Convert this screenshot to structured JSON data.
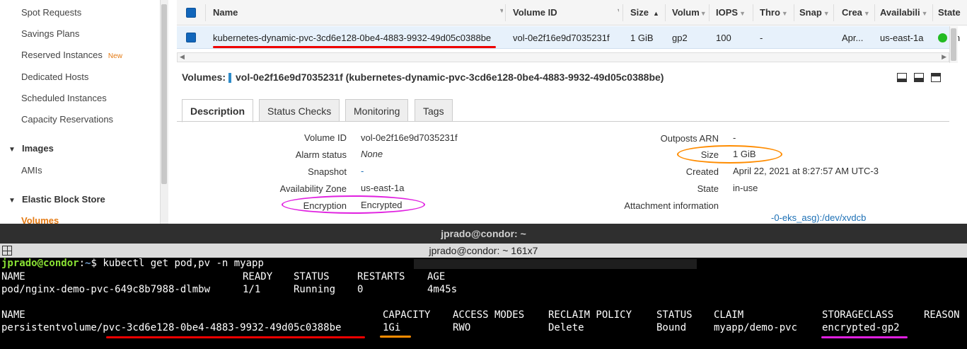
{
  "sidebar": {
    "items": [
      {
        "label": "Spot Requests"
      },
      {
        "label": "Savings Plans"
      },
      {
        "label": "Reserved Instances",
        "badge": "New"
      },
      {
        "label": "Dedicated Hosts"
      },
      {
        "label": "Scheduled Instances"
      },
      {
        "label": "Capacity Reservations"
      }
    ],
    "images_header": "Images",
    "images_items": [
      {
        "label": "AMIs"
      }
    ],
    "ebs_header": "Elastic Block Store",
    "ebs_items": [
      {
        "label": "Volumes"
      }
    ]
  },
  "table": {
    "columns": [
      "Name",
      "Volume ID",
      "Size",
      "Volum",
      "IOPS",
      "Thro",
      "Snap",
      "Crea",
      "Availabili",
      "State"
    ],
    "row": {
      "name": "kubernetes-dynamic-pvc-3cd6e128-0be4-4883-9932-49d05c0388be",
      "volume_id": "vol-0e2f16e9d7035231f",
      "size": "1 GiB",
      "volume_type": "gp2",
      "iops": "100",
      "throughput": "-",
      "created": "Apr...",
      "availability": "us-east-1a",
      "state": "in"
    }
  },
  "detail": {
    "title_prefix": "Volumes:",
    "title": "vol-0e2f16e9d7035231f (kubernetes-dynamic-pvc-3cd6e128-0be4-4883-9932-49d05c0388be)",
    "tabs": [
      "Description",
      "Status Checks",
      "Monitoring",
      "Tags"
    ],
    "left": [
      {
        "label": "Volume ID",
        "value": "vol-0e2f16e9d7035231f"
      },
      {
        "label": "Alarm status",
        "value": "None"
      },
      {
        "label": "Snapshot",
        "value": "-"
      },
      {
        "label": "Availability Zone",
        "value": "us-east-1a"
      },
      {
        "label": "Encryption",
        "value": "Encrypted"
      }
    ],
    "right": [
      {
        "label": "Outposts ARN",
        "value": "-"
      },
      {
        "label": "Size",
        "value": "1 GiB"
      },
      {
        "label": "Created",
        "value": "April 22, 2021 at 8:27:57 AM UTC-3"
      },
      {
        "label": "State",
        "value": "in-use"
      },
      {
        "label": "Attachment information",
        "value": "-0-eks_asg):/dev/xvdcb"
      }
    ]
  },
  "terminal": {
    "window_title": "jprado@condor: ~",
    "subtitle": "jprado@condor: ~ 161x7",
    "prompt_user": "jprado@condor",
    "prompt_sep": ":",
    "prompt_path": "~",
    "prompt_end": "$ ",
    "command": "kubectl get pod,pv -n myapp",
    "pod_headers": [
      "NAME",
      "READY",
      "STATUS",
      "RESTARTS",
      "AGE"
    ],
    "pod_row": [
      "pod/nginx-demo-pvc-649c8b7988-dlmbw",
      "1/1",
      "Running",
      "0",
      "4m45s"
    ],
    "pv_headers": [
      "NAME",
      "CAPACITY",
      "ACCESS MODES",
      "RECLAIM POLICY",
      "STATUS",
      "CLAIM",
      "STORAGECLASS",
      "REASON"
    ],
    "pv_row": [
      "persistentvolume/pvc-3cd6e128-0be4-4883-9932-49d05c0388be",
      "1Gi",
      "RWO",
      "Delete",
      "Bound",
      "myapp/demo-pvc",
      "encrypted-gp2",
      ""
    ]
  },
  "colors": {
    "accent_orange": "#e47911",
    "annotation_red": "#ee0000",
    "annotation_orange": "#ff8c00",
    "annotation_magenta": "#e020e0",
    "selected_row": "#e7f1fb",
    "terminal_bg": "#000000"
  }
}
